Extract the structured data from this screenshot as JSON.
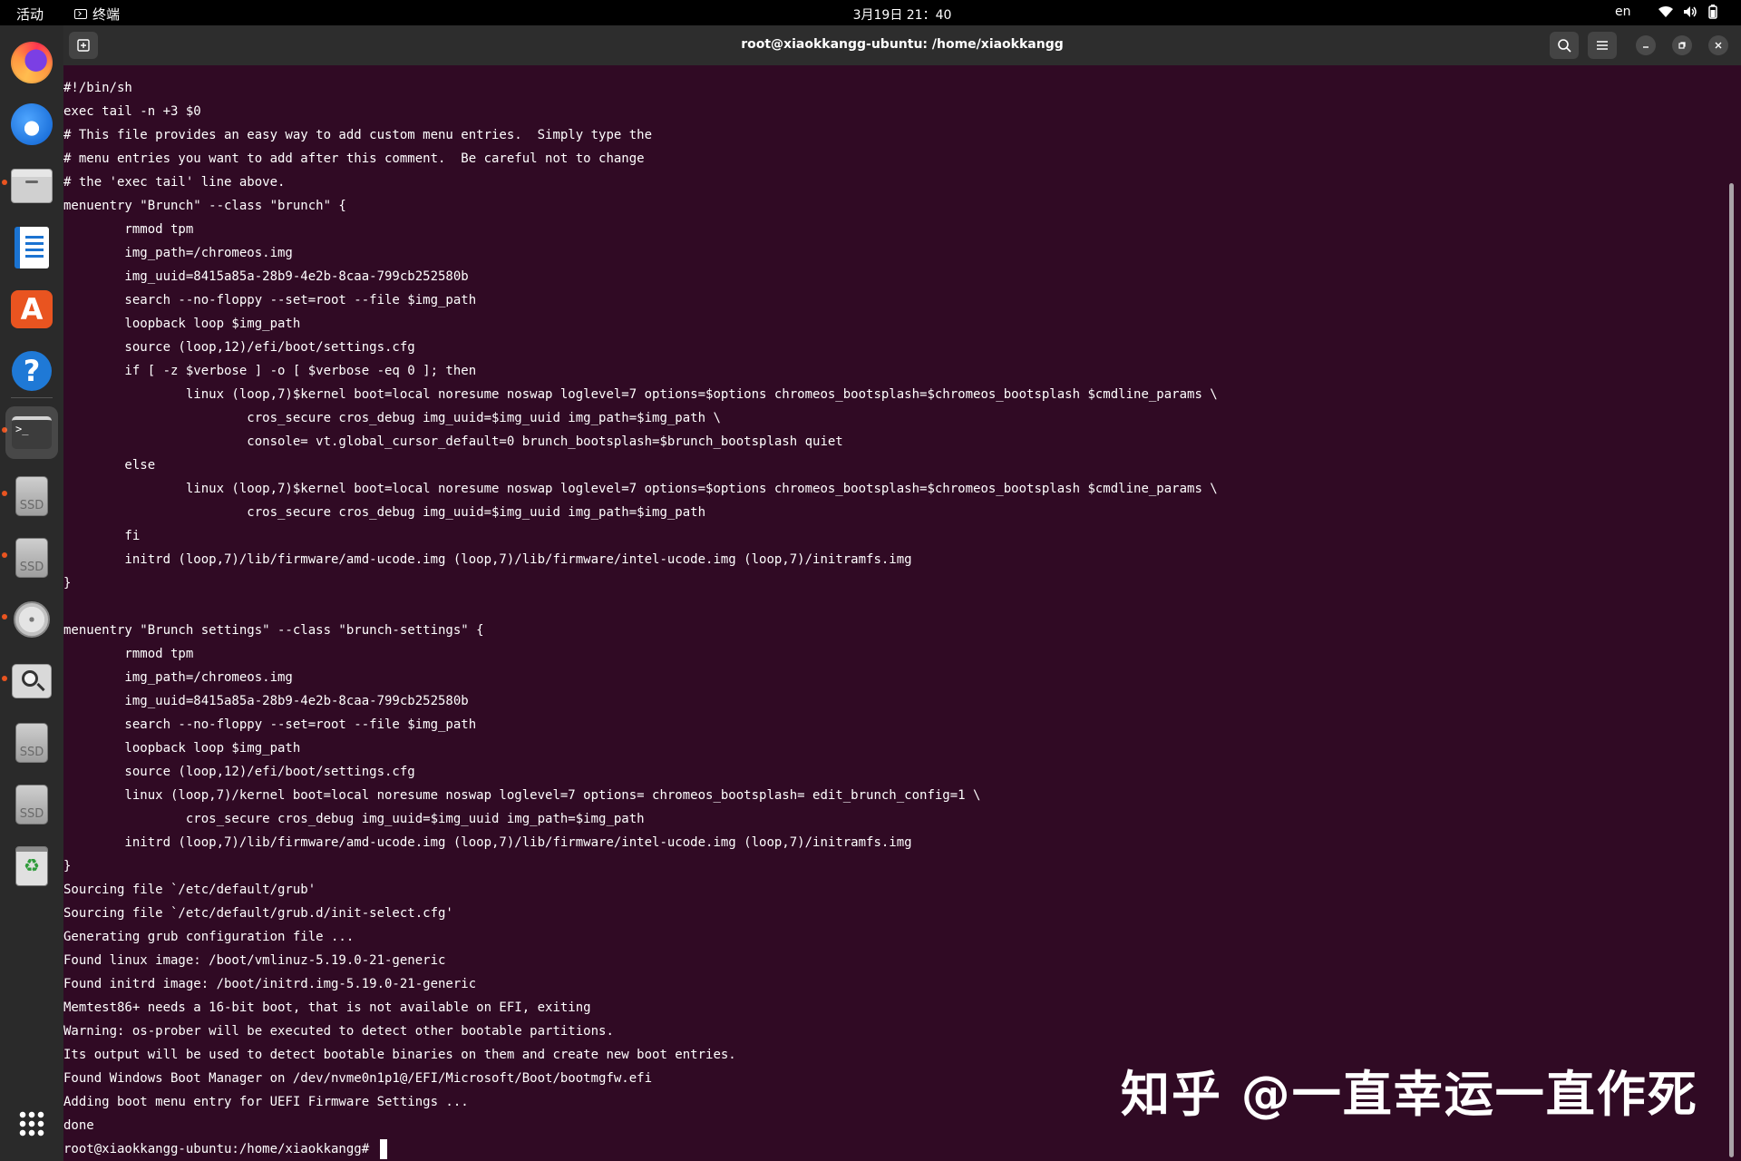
{
  "topbar": {
    "activities": "活动",
    "app_name": "终端",
    "clock": "3月19日 21：40",
    "lang": "en"
  },
  "window": {
    "title": "root@xiaokkangg-ubuntu: /home/xiaokkangg"
  },
  "terminal": {
    "lines": [
      "#!/bin/sh",
      "exec tail -n +3 $0",
      "# This file provides an easy way to add custom menu entries.  Simply type the",
      "# menu entries you want to add after this comment.  Be careful not to change",
      "# the 'exec tail' line above.",
      "menuentry \"Brunch\" --class \"brunch\" {",
      "        rmmod tpm",
      "        img_path=/chromeos.img",
      "        img_uuid=8415a85a-28b9-4e2b-8caa-799cb252580b",
      "        search --no-floppy --set=root --file $img_path",
      "        loopback loop $img_path",
      "        source (loop,12)/efi/boot/settings.cfg",
      "        if [ -z $verbose ] -o [ $verbose -eq 0 ]; then",
      "                linux (loop,7)$kernel boot=local noresume noswap loglevel=7 options=$options chromeos_bootsplash=$chromeos_bootsplash $cmdline_params \\",
      "                        cros_secure cros_debug img_uuid=$img_uuid img_path=$img_path \\",
      "                        console= vt.global_cursor_default=0 brunch_bootsplash=$brunch_bootsplash quiet",
      "        else",
      "                linux (loop,7)$kernel boot=local noresume noswap loglevel=7 options=$options chromeos_bootsplash=$chromeos_bootsplash $cmdline_params \\",
      "                        cros_secure cros_debug img_uuid=$img_uuid img_path=$img_path",
      "        fi",
      "        initrd (loop,7)/lib/firmware/amd-ucode.img (loop,7)/lib/firmware/intel-ucode.img (loop,7)/initramfs.img",
      "}",
      "",
      "menuentry \"Brunch settings\" --class \"brunch-settings\" {",
      "        rmmod tpm",
      "        img_path=/chromeos.img",
      "        img_uuid=8415a85a-28b9-4e2b-8caa-799cb252580b",
      "        search --no-floppy --set=root --file $img_path",
      "        loopback loop $img_path",
      "        source (loop,12)/efi/boot/settings.cfg",
      "        linux (loop,7)/kernel boot=local noresume noswap loglevel=7 options= chromeos_bootsplash= edit_brunch_config=1 \\",
      "                cros_secure cros_debug img_uuid=$img_uuid img_path=$img_path",
      "        initrd (loop,7)/lib/firmware/amd-ucode.img (loop,7)/lib/firmware/intel-ucode.img (loop,7)/initramfs.img",
      "}",
      "Sourcing file `/etc/default/grub'",
      "Sourcing file `/etc/default/grub.d/init-select.cfg'",
      "Generating grub configuration file ...",
      "Found linux image: /boot/vmlinuz-5.19.0-21-generic",
      "Found initrd image: /boot/initrd.img-5.19.0-21-generic",
      "Memtest86+ needs a 16-bit boot, that is not available on EFI, exiting",
      "Warning: os-prober will be executed to detect other bootable partitions.",
      "Its output will be used to detect bootable binaries on them and create new boot entries.",
      "Found Windows Boot Manager on /dev/nvme0n1p1@/EFI/Microsoft/Boot/bootmgfw.efi",
      "Adding boot menu entry for UEFI Firmware Settings ...",
      "done"
    ],
    "prompt": "root@xiaokkangg-ubuntu:/home/xiaokkangg# "
  },
  "watermark": "知乎 @一直幸运一直作死",
  "icons": {
    "dock": [
      "firefox-icon",
      "thunderbird-icon",
      "files-icon",
      "libreoffice-writer-icon",
      "app-center-icon",
      "help-icon",
      "terminal-icon",
      "ssd-drive-icon",
      "ssd-drive-icon",
      "disk-icon",
      "disk-search-icon",
      "ssd-drive-icon",
      "ssd-drive-icon",
      "trash-icon",
      "app-grid-icon"
    ]
  },
  "colors": {
    "terminal_bg": "#300a24",
    "accent": "#e95420",
    "titlebar_bg": "#2d2d2d"
  }
}
